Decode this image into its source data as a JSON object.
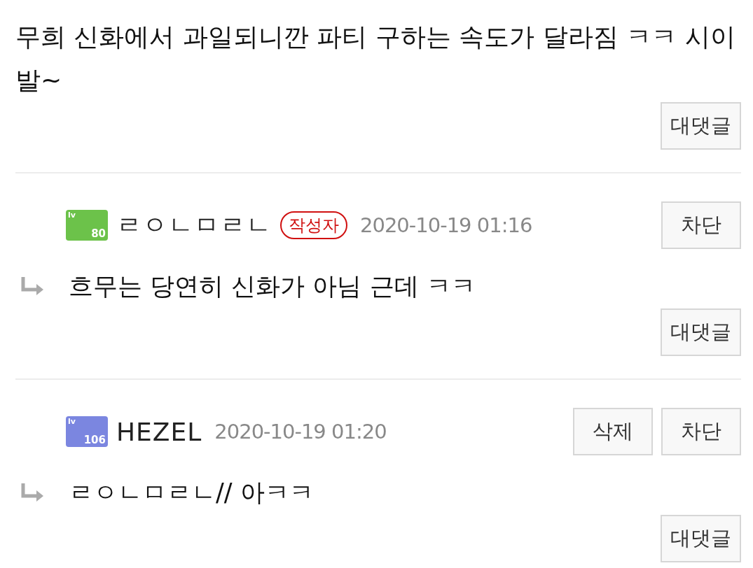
{
  "top_comment": {
    "text": "무희 신화에서 과일되니깐 파티 구하는 속도가 달라짐 ㅋㅋ 시이발~",
    "reply_button": "대댓글"
  },
  "replies": [
    {
      "level_label": "lv",
      "level": "80",
      "color": "#6cc24a",
      "nickname": "ㄹㅇㄴㅁㄹㄴ",
      "badge": "작성자",
      "date": "2020-10-19 01:16",
      "buttons": [
        "차단"
      ],
      "text": "흐무는 당연히 신화가 아님 근데 ㅋㅋ",
      "reply_button": "대댓글"
    },
    {
      "level_label": "lv",
      "level": "106",
      "color": "#7b86e0",
      "nickname": "HEZEL",
      "date": "2020-10-19 01:20",
      "buttons": [
        "삭제",
        "차단"
      ],
      "text": "ㄹㅇㄴㅁㄹㄴ// 아ㅋㅋ",
      "reply_button": "대댓글"
    }
  ]
}
